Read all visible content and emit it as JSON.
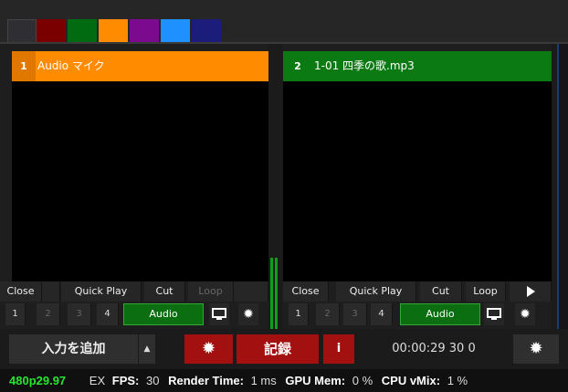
{
  "colors": {
    "swatches": [
      "#7a0000",
      "#006b10",
      "#ff8c00",
      "#7b0a8f",
      "#1e90ff",
      "#1c1c7a"
    ],
    "input1": "#ff8c00",
    "input2": "#0b7a12",
    "record": "#a31010",
    "status_res": "#27e630"
  },
  "inputs": [
    {
      "number": "1",
      "title": "Audio マイク",
      "controls": [
        "Close",
        "Quick Play",
        "Cut",
        "Loop"
      ],
      "overlays": [
        "1",
        "2",
        "3",
        "4"
      ],
      "audio_label": "Audio",
      "icons": [
        "monitor-icon",
        "gear-icon"
      ]
    },
    {
      "number": "2",
      "title": "1-01 四季の歌.mp3",
      "controls": [
        "Close",
        "Quick Play",
        "Cut",
        "Loop"
      ],
      "overlays": [
        "1",
        "2",
        "3",
        "4"
      ],
      "audio_label": "Audio",
      "icons": [
        "play-icon",
        "monitor-icon",
        "gear-icon"
      ]
    }
  ],
  "toolbar": {
    "add_input": "入力を追加",
    "caret_icon": "caret-up-icon",
    "record": "記録",
    "info": "i",
    "timecode": "00:00:29 30 0"
  },
  "status": {
    "resolution": "480p29.97",
    "ex": "EX",
    "fps_label": "FPS:",
    "fps_value": "30",
    "render_label": "Render Time:",
    "render_value": "1 ms",
    "gpu_label": "GPU Mem:",
    "gpu_value": "0 %",
    "cpu_label": "CPU vMix:",
    "cpu_value": "1 %"
  }
}
